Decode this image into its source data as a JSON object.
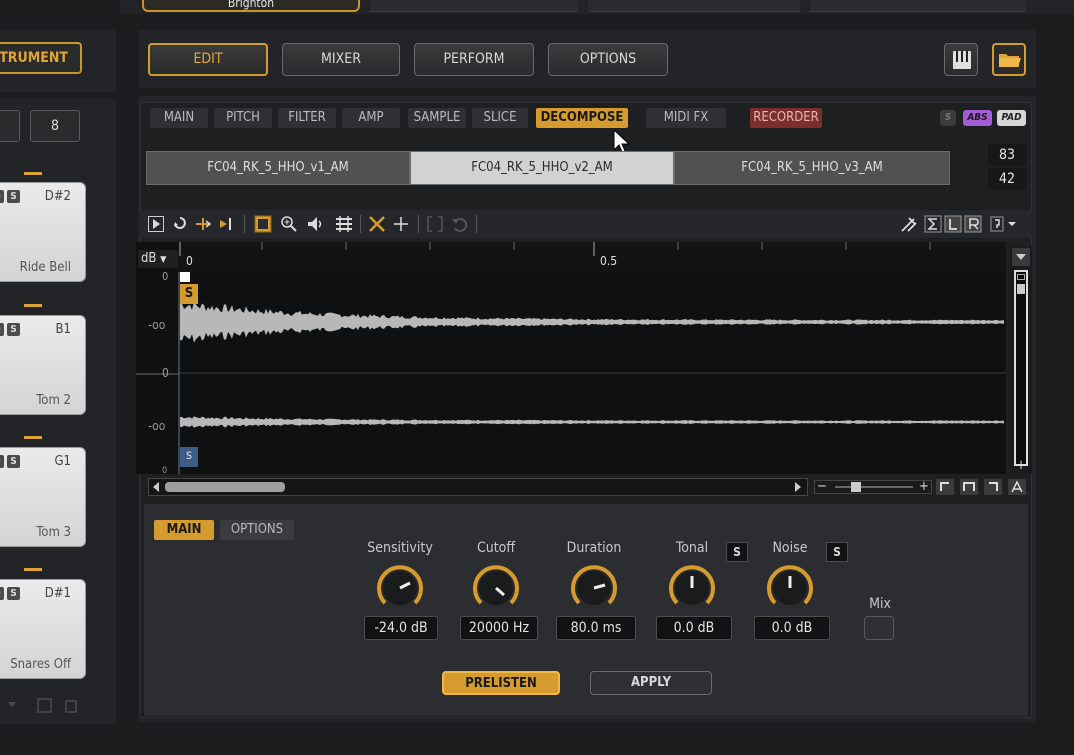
{
  "window": {
    "top_tab": "Brighton"
  },
  "left": {
    "instrument_label": "STRUMENT",
    "small_btn_right": "8",
    "pads": [
      {
        "note": "D#2",
        "name": "Ride Bell"
      },
      {
        "note": "B1",
        "name": "Tom 2"
      },
      {
        "note": "G1",
        "name": "Tom 3"
      },
      {
        "note": "D#1",
        "name": "Snares Off"
      }
    ]
  },
  "nav": {
    "edit": "EDIT",
    "mixer": "MIXER",
    "perform": "PERFORM",
    "options": "OPTIONS"
  },
  "icons": {
    "keyboard": "keyboard-icon",
    "folder": "folder-icon"
  },
  "colors": {
    "accent": "#d69b2e",
    "recorder": "#7a2f2a",
    "abs_flag": "#a45bd6",
    "marker_s_top": "#d69b2e",
    "marker_s_bottom": "#3e5d86"
  },
  "sub_tabs": {
    "main": "MAIN",
    "pitch": "PITCH",
    "filter": "FILTER",
    "amp": "AMP",
    "sample": "SAMPLE",
    "slice": "SLICE",
    "decompose": "DECOMPOSE",
    "midifx": "MIDI FX",
    "recorder": "RECORDER"
  },
  "flags": {
    "s": "S",
    "abs": "ABS",
    "pad": "PAD"
  },
  "layers": {
    "v1": "FC04_RK_5_HHO_v1_AM",
    "v2": "FC04_RK_5_HHO_v2_AM",
    "v3": "FC04_RK_5_HHO_v3_AM",
    "num_top": "83",
    "num_bottom": "42"
  },
  "wave": {
    "db_label": "dB",
    "ruler_start": "0",
    "ruler_mid": "0.5",
    "scale_top": "0",
    "scale_inf1": "-oo",
    "scale_zero": "0",
    "scale_inf2": "-oo",
    "scale_bottom": "0",
    "marker_top": "S",
    "marker_bottom": "s"
  },
  "decompose": {
    "tab_main": "MAIN",
    "tab_options": "OPTIONS",
    "sensitivity_label": "Sensitivity",
    "sensitivity_value": "-24.0 dB",
    "cutoff_label": "Cutoff",
    "cutoff_value": "20000 Hz",
    "duration_label": "Duration",
    "duration_value": "80.0 ms",
    "tonal_label": "Tonal",
    "tonal_value": "0.0 dB",
    "noise_label": "Noise",
    "noise_value": "0.0 dB",
    "solo": "S",
    "mix_label": "Mix",
    "prelisten": "PRELISTEN",
    "apply": "APPLY"
  }
}
